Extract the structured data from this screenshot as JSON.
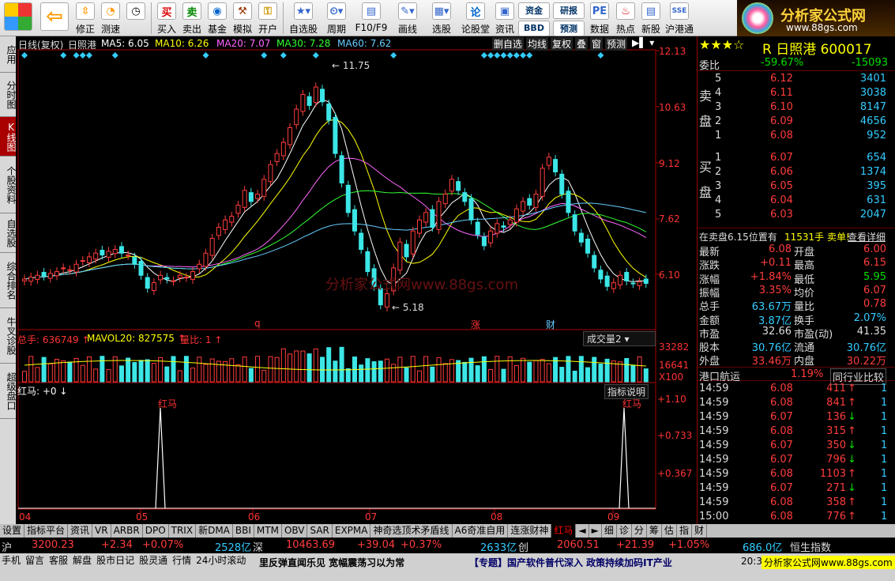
{
  "toolbar": {
    "items": [
      "",
      "修正",
      "测速",
      "买入",
      "卖出",
      "基金",
      "模拟",
      "开户",
      "自选股",
      "周期",
      "F10/F9",
      "画线",
      "选股",
      "论股堂",
      "资讯",
      "资金",
      "研报",
      "数据",
      "热点",
      "新股",
      "沪港通"
    ],
    "bbd": "BBD",
    "yuce": "预测",
    "logo_text": "分析家公式网",
    "logo_url": "www.88gs.com"
  },
  "left_tabs": [
    "应用",
    "分时图",
    "K线图",
    "个股资料",
    "自选股",
    "综合排名",
    "牛叉诊股",
    "超级盘口"
  ],
  "chart": {
    "mode": "日线(复权)",
    "name": "日照港",
    "ma5": "MA5: 6.05",
    "ma10": "MA10: 6.26",
    "ma20": "MA20: 7.07",
    "ma30": "MA30: 7.28",
    "ma60": "MA60: 7.62",
    "buttons": [
      "删自选",
      "均线",
      "复权",
      "叠",
      "窗",
      "预测"
    ],
    "price_ticks": [
      "12.13",
      "10.63",
      "9.12",
      "7.62",
      "6.10"
    ],
    "high_label": "11.75",
    "low_label": "5.18",
    "watermark": "分析家公式网www.88gs.com",
    "markers": [
      "q",
      "涨",
      "财"
    ],
    "vol_line": "总手: 636749",
    "mavol": "MAVOL20: 827575",
    "liangbi": "量比: 1",
    "vol_btn": "成交量2",
    "vol_ticks": [
      "33282",
      "16641",
      "X100"
    ],
    "ind_name": "红马: +0",
    "ind_btn": "指标说明",
    "ind_ticks": [
      "+1.10",
      "+0.733",
      "+0.367"
    ],
    "ind_label": "红马",
    "months": [
      "04",
      "05",
      "06",
      "07",
      "08",
      "09"
    ]
  },
  "chart_data": {
    "type": "candlestick",
    "close": [
      6.2,
      6.25,
      6.3,
      6.28,
      6.35,
      6.4,
      6.5,
      6.45,
      6.6,
      6.7,
      6.8,
      6.9,
      6.85,
      6.95,
      7.0,
      6.9,
      6.85,
      6.6,
      6.3,
      5.95,
      6.1,
      6.3,
      6.2,
      6.15,
      6.3,
      6.25,
      6.4,
      6.6,
      6.9,
      7.3,
      7.6,
      7.8,
      7.9,
      8.2,
      8.6,
      8.3,
      8.5,
      8.9,
      9.3,
      9.6,
      9.9,
      10.3,
      10.8,
      11.2,
      10.9,
      11.4,
      11.0,
      10.5,
      9.6,
      8.8,
      8.0,
      7.5,
      7.0,
      6.4,
      6.0,
      5.5,
      5.8,
      6.5,
      7.2,
      6.8,
      7.5,
      7.8,
      8.0,
      7.6,
      8.3,
      8.5,
      8.9,
      8.6,
      8.3,
      7.8,
      7.4,
      7.1,
      7.5,
      7.7,
      7.6,
      7.8,
      8.1,
      8.3,
      8.2,
      8.5,
      9.2,
      9.5,
      9.1,
      8.5,
      8.0,
      7.5,
      7.2,
      6.9,
      6.5,
      6.2,
      6.0,
      6.1,
      6.3,
      6.15,
      6.08,
      6.12,
      6.08
    ]
  },
  "quote": {
    "name": "R 日照港 600017",
    "weibi_l": "委比",
    "weibi": "-59.67%",
    "weicha": "-15093",
    "sell_label": "卖盘",
    "buy_label": "买盘",
    "sell": [
      [
        "5",
        "6.12",
        "3401"
      ],
      [
        "4",
        "6.11",
        "3038"
      ],
      [
        "3",
        "6.10",
        "8147"
      ],
      [
        "2",
        "6.09",
        "4656"
      ],
      [
        "1",
        "6.08",
        "952"
      ]
    ],
    "buy": [
      [
        "1",
        "6.07",
        "654"
      ],
      [
        "2",
        "6.06",
        "1374"
      ],
      [
        "3",
        "6.05",
        "395"
      ],
      [
        "4",
        "6.04",
        "631"
      ],
      [
        "5",
        "6.03",
        "2047"
      ]
    ],
    "note": "在卖盘6.15位置有",
    "note2": "11531手 卖单!",
    "note3": "查看详细",
    "stats": [
      [
        "最新",
        "6.08",
        "开盘",
        "6.00"
      ],
      [
        "涨跌",
        "+0.11",
        "最高",
        "6.15"
      ],
      [
        "涨幅",
        "+1.84%",
        "最低",
        "5.95"
      ],
      [
        "振幅",
        "3.35%",
        "均价",
        "6.07"
      ],
      [
        "总手",
        "63.67万",
        "量比",
        "0.78"
      ],
      [
        "金额",
        "3.87亿",
        "换手",
        "2.07%"
      ],
      [
        "市盈",
        "32.66",
        "市盈(动)",
        "41.35"
      ],
      [
        "股本",
        "30.76亿",
        "流通",
        "30.76亿"
      ],
      [
        "外盘",
        "33.46万",
        "内盘",
        "30.22万"
      ]
    ],
    "industry": "港口航运",
    "ind_pct": "1.19%",
    "compare": "同行业比较",
    "ticks": [
      [
        "14:59",
        "6.08",
        "411",
        "1"
      ],
      [
        "14:59",
        "6.08",
        "841",
        "1"
      ],
      [
        "14:59",
        "6.07",
        "136",
        "1"
      ],
      [
        "14:59",
        "6.08",
        "315",
        "1"
      ],
      [
        "14:59",
        "6.07",
        "350",
        "1"
      ],
      [
        "14:59",
        "6.07",
        "796",
        "1"
      ],
      [
        "14:59",
        "6.08",
        "1103",
        "1"
      ],
      [
        "14:59",
        "6.07",
        "271",
        "1"
      ],
      [
        "14:59",
        "6.08",
        "358",
        "1"
      ],
      [
        "15:00",
        "6.08",
        "776",
        "1"
      ]
    ]
  },
  "bottom_tabs": [
    "设置",
    "指标平台",
    "资讯",
    "VR",
    "ARBR",
    "DPO",
    "TRIX",
    "新DMA",
    "BBI",
    "MTM",
    "OBV",
    "SAR",
    "EXPMA",
    "神奇选顶术矛盾线",
    "A6奇准自用",
    "连涨财神",
    "红马",
    "细",
    "诊",
    "分",
    "筹",
    "估",
    "指",
    "财"
  ],
  "index": {
    "sh": "沪",
    "sh_v": "3200.23",
    "sh_c": "+2.34",
    "sh_p": "+0.07%",
    "sh_a": "2528亿",
    "sz": "深",
    "sz_v": "10463.69",
    "sz_c": "+39.04",
    "sz_p": "+0.37%",
    "sz_a": "2633亿",
    "cy": "创",
    "cy_v": "2060.51",
    "cy_c": "+21.39",
    "cy_p": "+1.05%",
    "hs_a": "686.0亿",
    "hs": "恒生指数"
  },
  "status": {
    "items": [
      "手机",
      "留言",
      "客服",
      "解盘",
      "股市日记",
      "股灵通",
      "行情",
      "24小时滚动"
    ],
    "news1": "里反弹直闻乐见 宽幅震荡习以为常",
    "news2": "【专题】国产软件普代深入 政策持续加码IT产业",
    "time": "20:3",
    "logo": "分析家公式网www.88gs.com"
  }
}
